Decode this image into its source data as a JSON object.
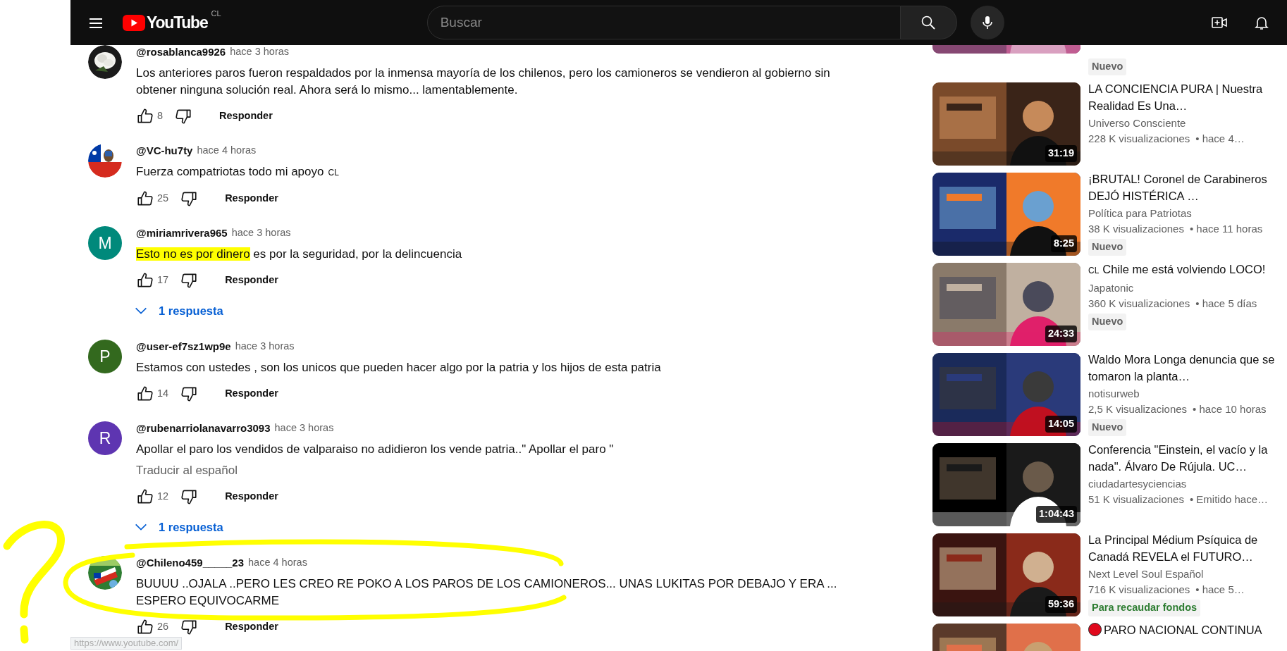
{
  "header": {
    "logo": "YouTube",
    "country": "CL",
    "search": {
      "placeholder": "Buscar"
    }
  },
  "comments": [
    {
      "author": "@rosablanca9926",
      "time": "hace 3 horas",
      "avatar": {
        "kind": "picture"
      },
      "text_parts": [
        {
          "kind": "plain",
          "text": "Los anteriores paros fueron respaldados por la inmensa mayoría de los chilenos, pero los camioneros se vendieron al gobierno sin obtener ninguna solución real. Ahora será lo mismo... lamentablemente."
        }
      ],
      "likes": "8",
      "reply_label": "Responder"
    },
    {
      "author": "@VC-hu7ty",
      "time": "hace 4 horas",
      "avatar": {
        "kind": "picture"
      },
      "text_parts": [
        {
          "kind": "plain",
          "text": "Fuerza compatriotas todo mi apoyo"
        },
        {
          "kind": "flag",
          "text": "CL"
        }
      ],
      "likes": "25",
      "reply_label": "Responder"
    },
    {
      "author": "@miriamrivera965",
      "time": "hace 3 horas",
      "avatar": {
        "kind": "letter",
        "letter": "M",
        "color": "#00897b"
      },
      "text_parts": [
        {
          "kind": "highlight",
          "text": "Esto no es por dinero"
        },
        {
          "kind": "plain",
          "text": " es por la seguridad, por la delincuencia"
        }
      ],
      "likes": "17",
      "reply_label": "Responder",
      "replies": "1 respuesta"
    },
    {
      "author": "@user-ef7sz1wp9e",
      "time": "hace 3 horas",
      "avatar": {
        "kind": "letter",
        "letter": "P",
        "color": "#33691e"
      },
      "text_parts": [
        {
          "kind": "plain",
          "text": "Estamos con ustedes , son los unicos que pueden hacer algo por la patria y los hijos de esta patria"
        }
      ],
      "likes": "14",
      "reply_label": "Responder"
    },
    {
      "author": "@rubenarriolanavarro3093",
      "time": "hace 3 horas",
      "avatar": {
        "kind": "letter",
        "letter": "R",
        "color": "#5e35b1"
      },
      "text_parts": [
        {
          "kind": "plain",
          "text": "Apollar el paro los vendidos de valparaiso no adidieron los vende patria..\" Apollar el paro \""
        }
      ],
      "translate": "Traducir al español",
      "likes": "12",
      "reply_label": "Responder",
      "replies": "1 respuesta"
    },
    {
      "author": "@Chileno459_____23",
      "time": "hace 4 horas",
      "avatar": {
        "kind": "picture"
      },
      "text_parts": [
        {
          "kind": "plain",
          "text": "BUUUU ..OJALA ..PERO LES CREO RE POKO A LOS PAROS DE LOS CAMIONEROS... UNAS LUKITAS POR DEBAJO Y ERA ... ESPERO EQUIVOCARME"
        }
      ],
      "likes": "26",
      "reply_label": "Responder"
    }
  ],
  "sidebar": [
    {
      "badge": {
        "kind": "new",
        "text": "Nuevo"
      }
    },
    {
      "title_parts": [
        {
          "kind": "plain",
          "text": "LA CONCIENCIA PURA | Nuestra Realidad Es Una…"
        }
      ],
      "duration": "31:19",
      "channel": "Universo Consciente",
      "views": "228 K visualizaciones",
      "age": "• hace 4…"
    },
    {
      "title_parts": [
        {
          "kind": "plain",
          "text": "¡BRUTAL! Coronel de Carabineros DEJÓ HISTÉRICA …"
        }
      ],
      "duration": "8:25",
      "channel": "Política para Patriotas",
      "views": "38 K visualizaciones",
      "age": "• hace 11 horas",
      "badge": {
        "kind": "new",
        "text": "Nuevo"
      }
    },
    {
      "title_parts": [
        {
          "kind": "flag",
          "text": "CL"
        },
        {
          "kind": "plain",
          "text": "Chile me está volviendo LOCO!"
        }
      ],
      "duration": "24:33",
      "channel": "Japatonic",
      "views": "360 K visualizaciones",
      "age": "• hace 5 días",
      "badge": {
        "kind": "new",
        "text": "Nuevo"
      }
    },
    {
      "title_parts": [
        {
          "kind": "plain",
          "text": "Waldo Mora Longa denuncia que se tomaron la planta…"
        }
      ],
      "duration": "14:05",
      "channel": "notisurweb",
      "views": "2,5 K visualizaciones",
      "age": "• hace 10 horas",
      "badge": {
        "kind": "new",
        "text": "Nuevo"
      }
    },
    {
      "title_parts": [
        {
          "kind": "plain",
          "text": "Conferencia \"Einstein, el vacío y la nada\". Álvaro De Rújula. UC…"
        }
      ],
      "duration": "1:04:43",
      "channel": "ciudadartesyciencias",
      "views": "51 K visualizaciones",
      "age": "• Emitido hace…"
    },
    {
      "title_parts": [
        {
          "kind": "plain",
          "text": "La Principal Médium Psíquica de Canadá REVELA el FUTURO…"
        }
      ],
      "duration": "59:36",
      "channel": "Next Level Soul Español",
      "views": "716 K visualizaciones",
      "age": "• hace 5…",
      "badge": {
        "kind": "fundraiser",
        "text": "Para recaudar fondos"
      }
    },
    {
      "title_parts": [
        {
          "kind": "dot"
        },
        {
          "kind": "plain",
          "text": "PARO NACIONAL CONTINUA"
        }
      ]
    }
  ],
  "status_link": "https://www.youtube.com/"
}
